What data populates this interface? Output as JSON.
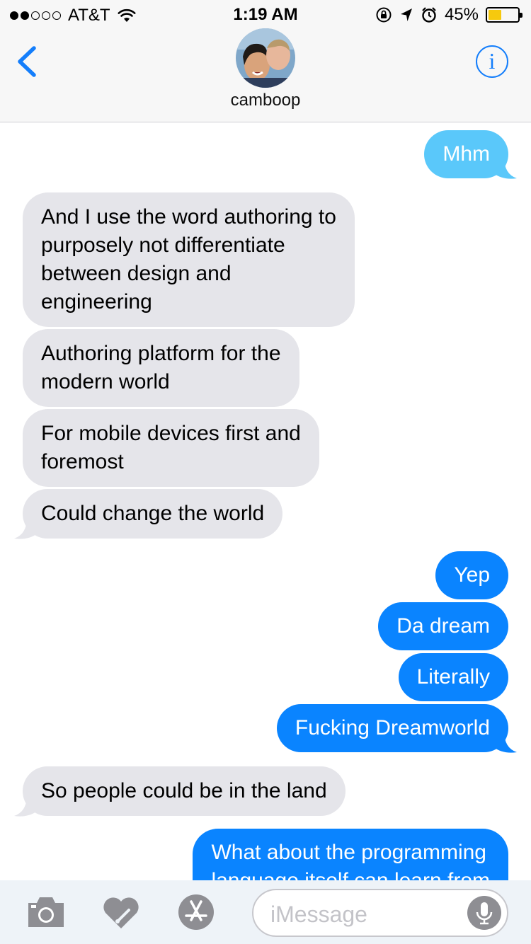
{
  "status_bar": {
    "carrier": "AT&T",
    "time": "1:19 AM",
    "battery_percent": "45%",
    "battery_level": 0.45,
    "battery_color": "#f6c90e",
    "signal_dots_filled": 2,
    "signal_dots_total": 5
  },
  "header": {
    "contact_name": "camboop",
    "back_icon": "chevron-left-icon",
    "info_icon": "info-icon",
    "info_glyph": "i"
  },
  "messages": [
    {
      "side": "out",
      "faded": true,
      "text": "Mhm"
    },
    {
      "side": "in",
      "text": "And I use the word authoring to\npurposely not differentiate\nbetween design and\nengineering"
    },
    {
      "side": "in",
      "text": "Authoring platform for the\nmodern world"
    },
    {
      "side": "in",
      "text": "For mobile devices first and\nforemost"
    },
    {
      "side": "in",
      "text": "Could change the world"
    },
    {
      "side": "out",
      "text": "Yep"
    },
    {
      "side": "out",
      "text": "Da dream"
    },
    {
      "side": "out",
      "text": "Literally"
    },
    {
      "side": "out",
      "text": "Fucking Dreamworld"
    },
    {
      "side": "in",
      "text": "So people could be in the land"
    },
    {
      "side": "out",
      "text": "What about the programming\nlanguage itself can learn from"
    }
  ],
  "input_bar": {
    "camera_icon": "camera-icon",
    "digital_touch_icon": "digital-touch-heart-icon",
    "app_store_icon": "app-store-icon",
    "placeholder": "iMessage",
    "mic_icon": "microphone-icon"
  },
  "colors": {
    "outgoing_bubble": "#0a84ff",
    "outgoing_faded_bubble": "#5ac8fa",
    "incoming_bubble": "#e5e5ea",
    "accent": "#147efb"
  }
}
